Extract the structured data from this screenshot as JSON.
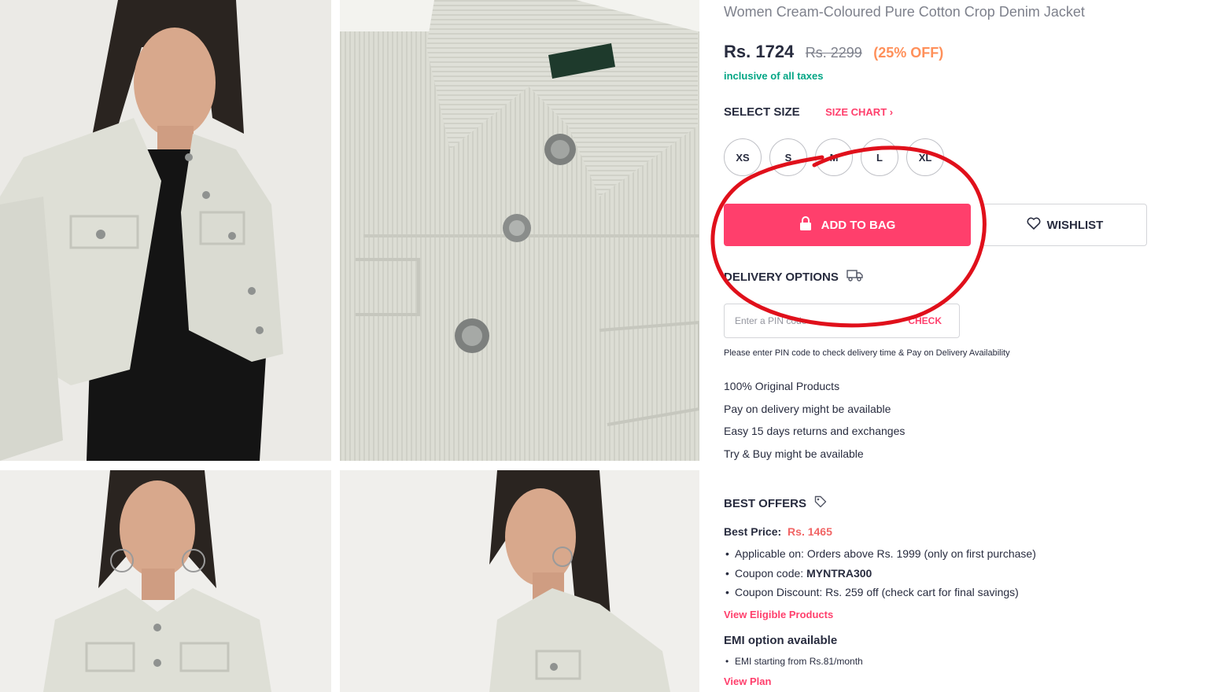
{
  "product": {
    "title": "Women Cream-Coloured Pure Cotton Crop Denim Jacket",
    "price": "Rs. 1724",
    "mrp": "Rs. 2299",
    "discount": "(25% OFF)",
    "tax_note": "inclusive of all taxes"
  },
  "size_section": {
    "label": "SELECT SIZE",
    "chart_link": "SIZE CHART",
    "chart_chevron": "›",
    "sizes": [
      "XS",
      "S",
      "M",
      "L",
      "XL"
    ]
  },
  "actions": {
    "add_to_bag": "ADD TO BAG",
    "wishlist": "WISHLIST"
  },
  "delivery": {
    "heading": "DELIVERY OPTIONS",
    "pin_placeholder": "Enter a PIN code",
    "check_label": "CHECK",
    "note": "Please enter PIN code to check delivery time & Pay on Delivery Availability"
  },
  "features": [
    "100% Original Products",
    "Pay on delivery might be available",
    "Easy 15 days returns and exchanges",
    "Try & Buy might be available"
  ],
  "offers": {
    "heading": "BEST OFFERS",
    "best_price_label": "Best Price:",
    "best_price_value": "Rs. 1465",
    "applicable_on": "Applicable on: Orders above Rs. 1999 (only on first purchase)",
    "coupon_code_label": "Coupon code:",
    "coupon_code": "MYNTRA300",
    "coupon_discount": "Coupon Discount: Rs. 259 off (check cart for final savings)",
    "view_eligible": "View Eligible Products"
  },
  "emi": {
    "heading": "EMI option available",
    "detail": "EMI starting from Rs.81/month",
    "view_plan": "View Plan"
  },
  "colors": {
    "accent_pink": "#ff3f6c",
    "discount_orange": "#ff905a",
    "tax_green": "#03a685",
    "annotation_red": "#e0101b"
  },
  "icons": {
    "lock": "lock-icon",
    "heart": "heart-icon",
    "truck": "truck-icon",
    "tag": "tag-icon",
    "chevron": "chevron-right-icon"
  }
}
